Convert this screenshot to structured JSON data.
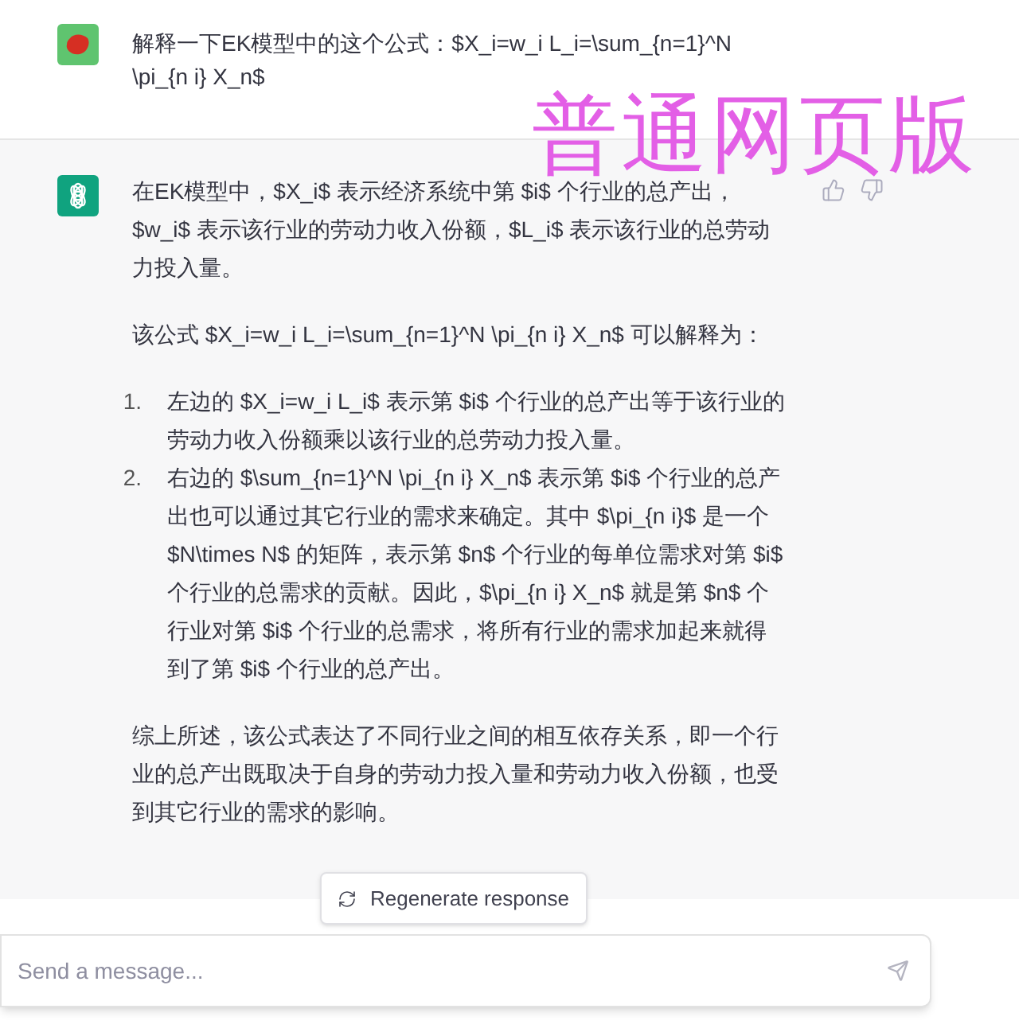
{
  "user_message": {
    "text": "解释一下EK模型中的这个公式：$X_i=w_i L_i=\\sum_{n=1}^N \\pi_{n i} X_n$"
  },
  "overlay_caption": "普通网页版",
  "assistant_message": {
    "paragraphs": [
      {
        "kind": "text",
        "text": "在EK模型中，$X_i$ 表示经济系统中第 $i$ 个行业的总产出，$w_i$ 表示该行业的劳动力收入份额，$L_i$ 表示该行业的总劳动力投入量。"
      },
      {
        "kind": "text",
        "text": "该公式 $X_i=w_i L_i=\\sum_{n=1}^N \\pi_{n i} X_n$ 可以解释为："
      },
      {
        "kind": "list",
        "items": [
          {
            "number": "1.",
            "text": "左边的 $X_i=w_i L_i$ 表示第 $i$ 个行业的总产出等于该行业的劳动力收入份额乘以该行业的总劳动力投入量。"
          },
          {
            "number": "2.",
            "text": "右边的 $\\sum_{n=1}^N \\pi_{n i} X_n$ 表示第 $i$ 个行业的总产出也可以通过其它行业的需求来确定。其中 $\\pi_{n i}$ 是一个 $N\\times N$ 的矩阵，表示第 $n$ 个行业的每单位需求对第 $i$ 个行业的总需求的贡献。因此，$\\pi_{n i} X_n$ 就是第 $n$ 个行业对第 $i$ 个行业的总需求，将所有行业的需求加起来就得到了第 $i$ 个行业的总产出。"
          }
        ]
      },
      {
        "kind": "text",
        "text": "综上所述，该公式表达了不同行业之间的相互依存关系，即一个行业的总产出既取决于自身的劳动力投入量和劳动力收入份额，也受到其它行业的需求的影响。"
      }
    ]
  },
  "regenerate_button": "Regenerate response",
  "message_input": {
    "placeholder": "Send a message..."
  }
}
